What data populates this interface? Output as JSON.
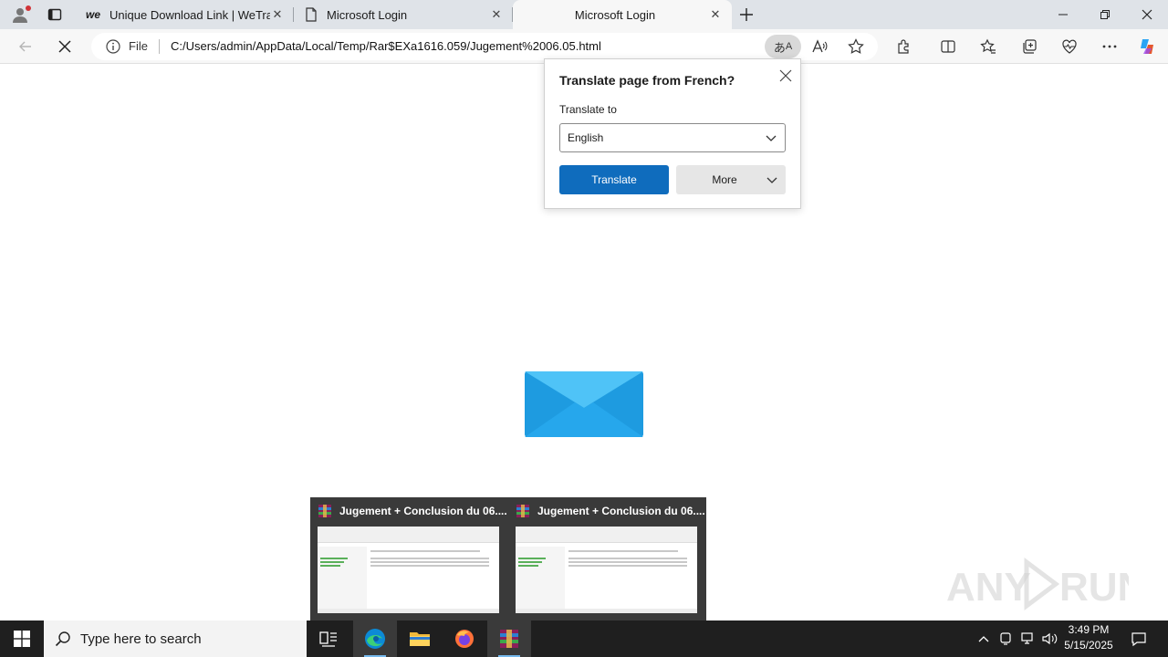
{
  "browser": {
    "tabs": [
      {
        "title": "Unique Download Link | WeTrans",
        "favicon": "wetransfer-logo-icon",
        "active": false
      },
      {
        "title": "Microsoft Login",
        "favicon": "document-icon",
        "active": false
      },
      {
        "title": "Microsoft Login",
        "favicon": "none",
        "active": true
      }
    ],
    "address_bar": {
      "scheme_label": "File",
      "url": "C:/Users/admin/AppData/Local/Temp/Rar$EXa1616.059/Jugement%2006.05.html"
    }
  },
  "translate_popup": {
    "title": "Translate page from French?",
    "translate_to_label": "Translate to",
    "selected_language": "English",
    "translate_button": "Translate",
    "more_button": "More"
  },
  "taskbar_flyout": {
    "windows": [
      {
        "title": "Jugement + Conclusion du 06...."
      },
      {
        "title": "Jugement + Conclusion du 06...."
      }
    ]
  },
  "watermark": {
    "text": "ANY RUN"
  },
  "taskbar": {
    "search_placeholder": "Type here to search",
    "time": "3:49 PM",
    "date": "5/15/2025"
  },
  "colors": {
    "accent": "#0f6cbd",
    "envelope_light": "#4fc3f7",
    "envelope_dark": "#1e9be0"
  }
}
